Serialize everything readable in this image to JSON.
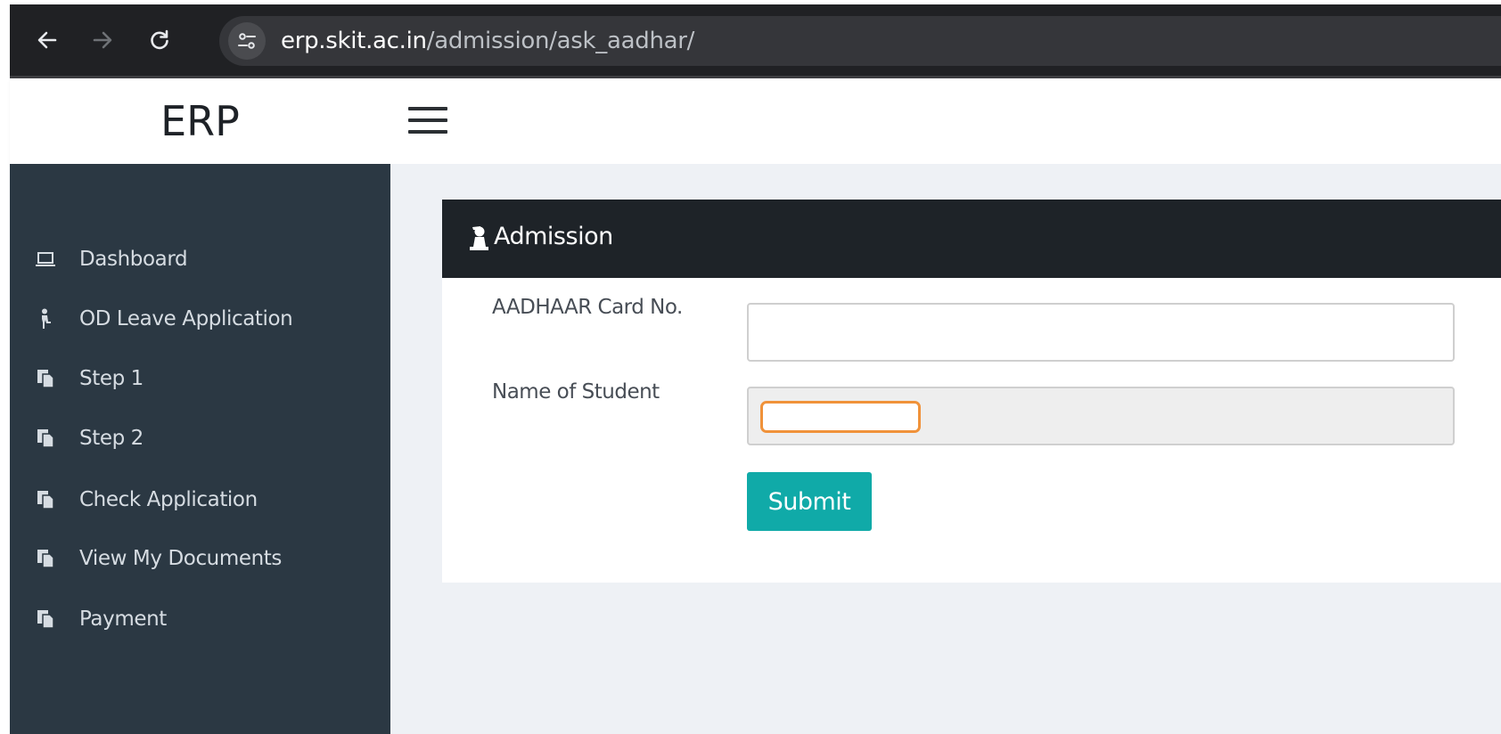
{
  "browser": {
    "url_host": "erp.skit.ac.in",
    "url_path": "/admission/ask_aadhar/",
    "icons": [
      "back-arrow-icon",
      "forward-arrow-icon",
      "reload-icon",
      "site-info-icon"
    ]
  },
  "header": {
    "brand": "ERP",
    "menu_icon": "hamburger-icon"
  },
  "sidebar": {
    "items": [
      {
        "label": "Dashboard",
        "icon": "laptop-icon"
      },
      {
        "label": "OD Leave Application",
        "icon": "person-icon"
      },
      {
        "label": "Step 1",
        "icon": "documents-icon"
      },
      {
        "label": "Step 2",
        "icon": "documents-icon"
      },
      {
        "label": "Check Application",
        "icon": "documents-icon"
      },
      {
        "label": "View My Documents",
        "icon": "documents-icon"
      },
      {
        "label": "Payment",
        "icon": "documents-icon"
      }
    ]
  },
  "card": {
    "title": "Admission",
    "title_icon": "student-icon"
  },
  "form": {
    "aadhaar_label": "AADHAAR Card No.",
    "aadhaar_value": "",
    "name_label": "Name of Student",
    "name_value": "",
    "submit_label": "Submit"
  },
  "colors": {
    "sidebar_bg": "#2b3843",
    "card_header_bg": "#1e2328",
    "submit_bg": "#10aaa8",
    "highlight": "#f0923a",
    "content_bg": "#eef1f5"
  }
}
